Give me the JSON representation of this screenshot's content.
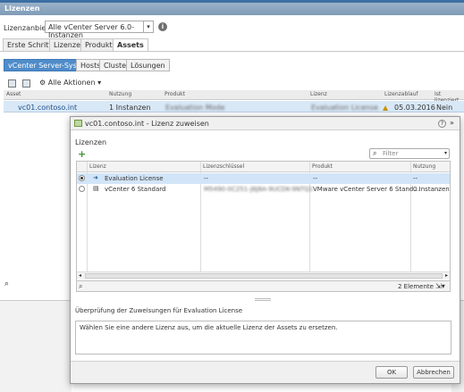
{
  "window": {
    "title": "Lizenzen"
  },
  "provider": {
    "label": "Lizenzanbieter:",
    "value": "Alle vCenter Server 6.0-Instanzen"
  },
  "tabs": [
    {
      "label": "Erste Schritte"
    },
    {
      "label": "Lizenzen"
    },
    {
      "label": "Produkte"
    },
    {
      "label": "Assets"
    }
  ],
  "subtabs": [
    {
      "label": "vCenter Server-Systeme"
    },
    {
      "label": "Hosts"
    },
    {
      "label": "Cluster"
    },
    {
      "label": "Lösungen"
    }
  ],
  "toolbar": {
    "all_actions": "Alle Aktionen"
  },
  "asset_grid": {
    "headers": [
      "Asset",
      "Nutzung",
      "Produkt",
      "Lizenz",
      "Lizenzablauf",
      "Ist lizenziert"
    ],
    "row": {
      "asset": "vc01.contoso.int",
      "usage": "1 Instanzen",
      "product": "Evaluation Mode",
      "license": "Evaluation License",
      "expiry": "05.03.2016",
      "licensed": "Nein"
    }
  },
  "dialog": {
    "title": "vc01.contoso.int - Lizenz zuweisen",
    "section": "Lizenzen",
    "filter_placeholder": "Filter",
    "headers": [
      "Lizenz",
      "Lizenzschlüssel",
      "Produkt",
      "Nutzung"
    ],
    "rows": [
      {
        "license": "Evaluation License",
        "key": "--",
        "product": "--",
        "usage": "--",
        "selected": true
      },
      {
        "license": "vCenter 6 Standard",
        "key": "M5490-0C251-J8J8A-9UCDK-9NTQ1",
        "product": "VMware vCenter Server 6 Stand...",
        "usage": "0 Instanzen",
        "selected": false
      }
    ],
    "count": "2 Elemente",
    "validation_label": "Überprüfung der Zuweisungen für Evaluation License",
    "validation_text": "Wählen Sie eine andere Lizenz aus, um die aktuelle Lizenz der Assets zu ersetzen.",
    "ok": "OK",
    "cancel": "Abbrechen"
  }
}
